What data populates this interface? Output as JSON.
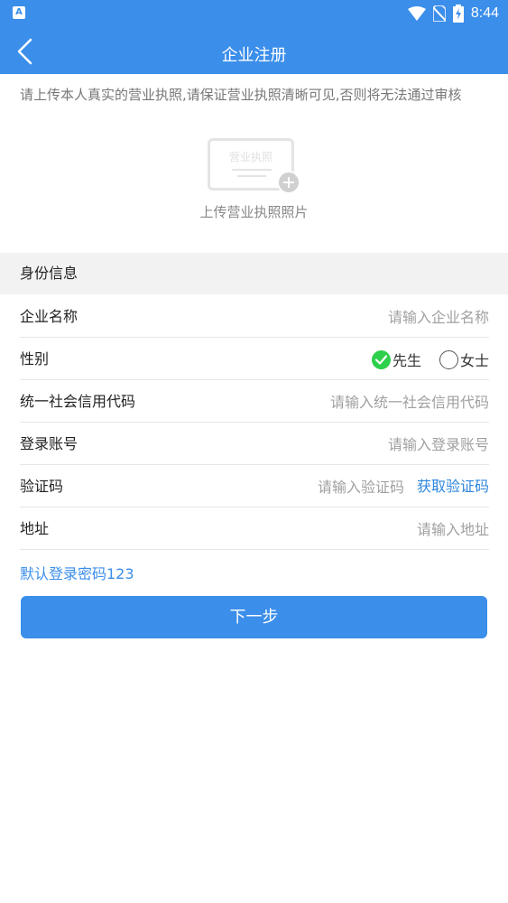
{
  "status_bar": {
    "app_badge": "A",
    "time": "8:44",
    "icons": [
      "wifi-icon",
      "no-sim-icon",
      "battery-charging-icon"
    ]
  },
  "nav": {
    "title": "企业注册",
    "back_icon": "chevron-left-icon"
  },
  "notice": "请上传本人真实的营业执照,请保证营业执照清晰可见,否则将无法通过审核",
  "upload": {
    "card_text": "营业执照",
    "label": "上传营业执照照片",
    "plus_icon": "plus-circle-icon"
  },
  "section": {
    "title": "身份信息"
  },
  "form": {
    "company_name": {
      "label": "企业名称",
      "placeholder": "请输入企业名称",
      "value": ""
    },
    "gender": {
      "label": "性别",
      "options": [
        {
          "label": "先生",
          "selected": true
        },
        {
          "label": "女士",
          "selected": false
        }
      ]
    },
    "credit_code": {
      "label": "统一社会信用代码",
      "placeholder": "请输入统一社会信用代码",
      "value": ""
    },
    "account": {
      "label": "登录账号",
      "placeholder": "请输入登录账号",
      "value": ""
    },
    "verify_code": {
      "label": "验证码",
      "placeholder": "请输入验证码",
      "value": "",
      "get_code_label": "获取验证码"
    },
    "address": {
      "label": "地址",
      "placeholder": "请输入地址",
      "value": ""
    }
  },
  "default_password_note": "默认登录密码123",
  "next_button": "下一步",
  "colors": {
    "primary": "#3b8eea",
    "link": "#2e86de",
    "check_selected": "#2dd04b",
    "section_bg": "#f2f2f2"
  }
}
